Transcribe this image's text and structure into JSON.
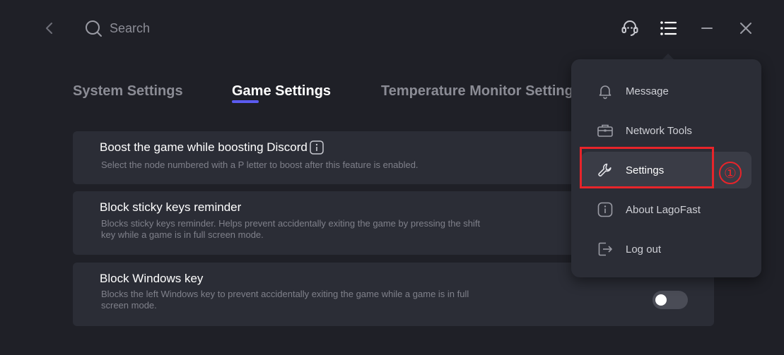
{
  "search": {
    "placeholder": "Search"
  },
  "tabs": [
    {
      "label": "System Settings"
    },
    {
      "label": "Game Settings"
    },
    {
      "label": "Temperature Monitor Settings"
    }
  ],
  "settings": [
    {
      "title": "Boost the game while boosting Discord",
      "description": "Select the node numbered with a P letter to boost after this feature is enabled."
    },
    {
      "title": "Block sticky keys reminder",
      "description": "Blocks sticky keys reminder. Helps prevent accidentally exiting the game by pressing the shift key while a game is in full screen mode."
    },
    {
      "title": "Block Windows key",
      "description": "Blocks the left Windows key to prevent accidentally exiting the game while a game is in full screen mode.",
      "enabled": false
    }
  ],
  "menu": {
    "items": [
      {
        "label": "Message",
        "icon": "bell-icon"
      },
      {
        "label": "Network Tools",
        "icon": "toolbox-icon"
      },
      {
        "label": "Settings",
        "icon": "wrench-icon"
      },
      {
        "label": "About LagoFast",
        "icon": "info-icon"
      },
      {
        "label": "Log out",
        "icon": "logout-icon"
      }
    ]
  },
  "annotation": {
    "step": "①"
  },
  "colors": {
    "background": "#1f2027",
    "card": "#2b2d36",
    "accent": "#5b5bf0",
    "highlight": "#e8242a"
  }
}
